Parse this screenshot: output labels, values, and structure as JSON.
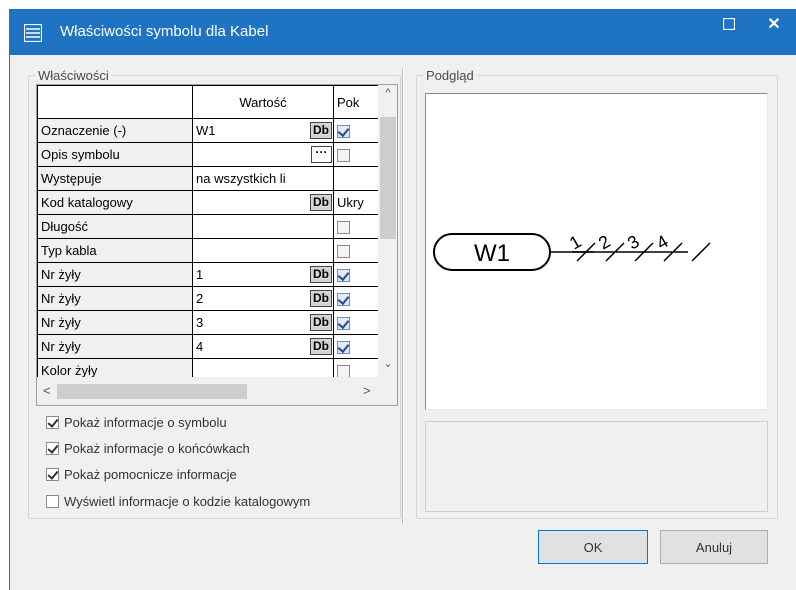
{
  "window": {
    "title": "Właściwości symbolu dla Kabel",
    "icon": "list-icon",
    "maximize_glyph": "☐",
    "close_glyph": "✕",
    "titlebar_color": "#1f73c3"
  },
  "properties": {
    "legend": "Właściwości",
    "columns": [
      "",
      "Wartość",
      "Pok"
    ],
    "rows": [
      {
        "name": "Oznaczenie (-)",
        "value": "W1",
        "button": "Db",
        "show": true
      },
      {
        "name": "Opis symbolu",
        "value": "",
        "button": "···",
        "show": false
      },
      {
        "name": "Występuje",
        "value": "na wszystkich li",
        "button": "",
        "show": null
      },
      {
        "name": "Kod katalogowy",
        "value": "",
        "button": "Db",
        "show_text": "Ukry"
      },
      {
        "name": "Długość",
        "value": "",
        "button": "",
        "show": false
      },
      {
        "name": "Typ kabla",
        "value": "",
        "button": "",
        "show": false
      },
      {
        "name": "Nr żyły",
        "value": "1",
        "button": "Db",
        "show": true
      },
      {
        "name": "Nr żyły",
        "value": "2",
        "button": "Db",
        "show": true
      },
      {
        "name": "Nr żyły",
        "value": "3",
        "button": "Db",
        "show": true
      },
      {
        "name": "Nr żyły",
        "value": "4",
        "button": "Db",
        "show": true
      },
      {
        "name": "Kolor żyły",
        "value": "",
        "button": "",
        "show": false
      }
    ],
    "scroll_up": "^",
    "scroll_down": "⌄",
    "scroll_left": "<",
    "scroll_right": ">"
  },
  "options": [
    {
      "label": "Pokaż informacje o symbolu",
      "checked": true
    },
    {
      "label": "Pokaż informacje o końcówkach",
      "checked": true
    },
    {
      "label": "Pokaż pomocnicze informacje",
      "checked": true
    },
    {
      "label": "Wyświetl informacje o kodzie katalogowym",
      "checked": false
    }
  ],
  "preview": {
    "legend": "Podgląd",
    "symbol_label": "W1",
    "wire_numbers": [
      "1",
      "2",
      "3",
      "4"
    ]
  },
  "buttons": {
    "ok": "OK",
    "cancel": "Anuluj"
  }
}
